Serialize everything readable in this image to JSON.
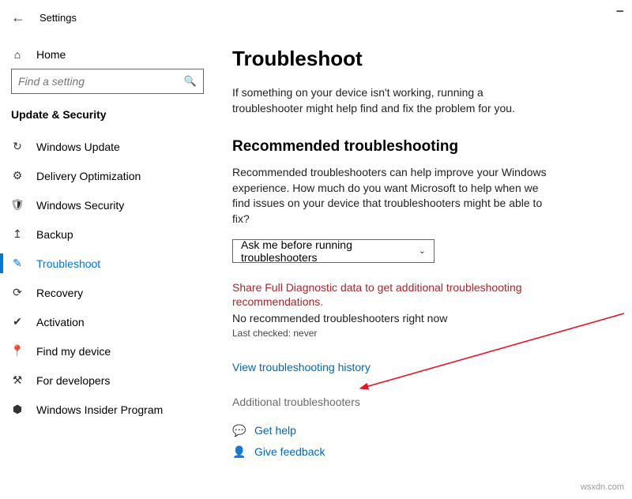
{
  "header": {
    "back_aria": "Back",
    "title": "Settings",
    "minimize_aria": "Minimize"
  },
  "sidebar": {
    "home_label": "Home",
    "search_placeholder": "Find a setting",
    "section_title": "Update & Security",
    "items": [
      {
        "icon": "sync-icon",
        "glyph": "↻",
        "label": "Windows Update",
        "selected": false
      },
      {
        "icon": "delivery-icon",
        "glyph": "⚙",
        "label": "Delivery Optimization",
        "selected": false
      },
      {
        "icon": "shield-icon",
        "glyph": "🛡",
        "label": "Windows Security",
        "selected": false
      },
      {
        "icon": "backup-icon",
        "glyph": "↥",
        "label": "Backup",
        "selected": false
      },
      {
        "icon": "troubleshoot-icon",
        "glyph": "✎",
        "label": "Troubleshoot",
        "selected": true
      },
      {
        "icon": "recovery-icon",
        "glyph": "⟳",
        "label": "Recovery",
        "selected": false
      },
      {
        "icon": "activation-icon",
        "glyph": "✔",
        "label": "Activation",
        "selected": false
      },
      {
        "icon": "findmydevice-icon",
        "glyph": "📍",
        "label": "Find my device",
        "selected": false
      },
      {
        "icon": "developers-icon",
        "glyph": "⚒",
        "label": "For developers",
        "selected": false
      },
      {
        "icon": "insider-icon",
        "glyph": "⬢",
        "label": "Windows Insider Program",
        "selected": false
      }
    ]
  },
  "main": {
    "title": "Troubleshoot",
    "intro": "If something on your device isn't working, running a troubleshooter might help find and fix the problem for you.",
    "rec_heading": "Recommended troubleshooting",
    "rec_text": "Recommended troubleshooters can help improve your Windows experience. How much do you want Microsoft to help when we find issues on your device that troubleshooters might be able to fix?",
    "dropdown_value": "Ask me before running troubleshooters",
    "warn": "Share Full Diagnostic data to get additional troubleshooting recommendations.",
    "no_rec": "No recommended troubleshooters right now",
    "last_checked": "Last checked: never",
    "history_link": "View troubleshooting history",
    "additional": "Additional troubleshooters",
    "get_help": "Get help",
    "give_feedback": "Give feedback"
  },
  "watermark": "wsxdn.com"
}
